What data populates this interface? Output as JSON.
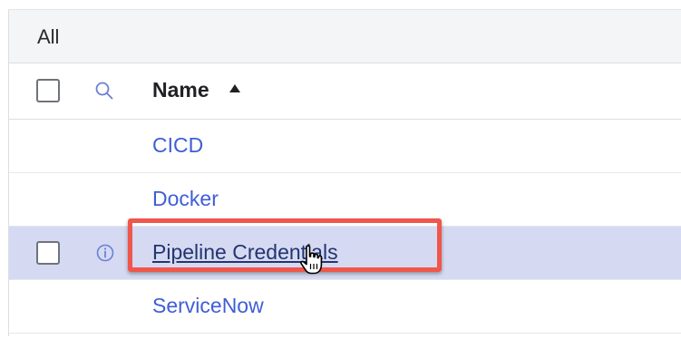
{
  "filter": {
    "label": "All"
  },
  "table": {
    "header": {
      "name_label": "Name",
      "sort_direction": "ascending"
    },
    "rows": [
      {
        "name": "CICD",
        "selected": false,
        "has_checkbox": false,
        "has_info_icon": false
      },
      {
        "name": "Docker",
        "selected": false,
        "has_checkbox": false,
        "has_info_icon": false
      },
      {
        "name": "Pipeline Credentials",
        "selected": true,
        "has_checkbox": true,
        "has_info_icon": true
      },
      {
        "name": "ServiceNow",
        "selected": false,
        "has_checkbox": false,
        "has_info_icon": false
      }
    ]
  },
  "annotation": {
    "highlight_color": "#f0564b",
    "cursor": "hand-pointer-icon"
  },
  "colors": {
    "link": "#3f5ed6",
    "selected_row": "#d5daf2",
    "header_bar": "#f4f5f7"
  }
}
